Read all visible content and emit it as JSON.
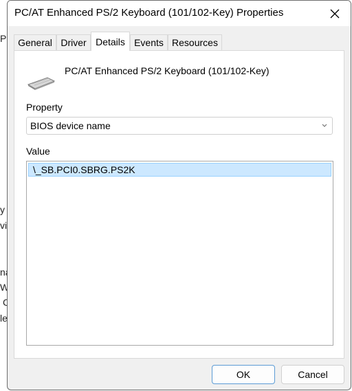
{
  "background_fragments": [
    "P(",
    "y",
    "vi",
    "na",
    "W",
    "C",
    "le"
  ],
  "dialog": {
    "title": "PC/AT Enhanced PS/2 Keyboard (101/102-Key) Properties"
  },
  "tabs": [
    {
      "label": "General",
      "active": false
    },
    {
      "label": "Driver",
      "active": false
    },
    {
      "label": "Details",
      "active": true
    },
    {
      "label": "Events",
      "active": false
    },
    {
      "label": "Resources",
      "active": false
    }
  ],
  "details": {
    "device_icon": "keyboard-icon",
    "device_name": "PC/AT Enhanced PS/2 Keyboard (101/102-Key)",
    "property_label": "Property",
    "property_selected": "BIOS device name",
    "value_label": "Value",
    "values": [
      "\\_SB.PCI0.SBRG.PS2K"
    ]
  },
  "buttons": {
    "ok": "OK",
    "cancel": "Cancel"
  },
  "colors": {
    "selection_bg": "#cce8ff",
    "selection_border": "#99d1ff",
    "default_button_border": "#5b9bd5"
  }
}
